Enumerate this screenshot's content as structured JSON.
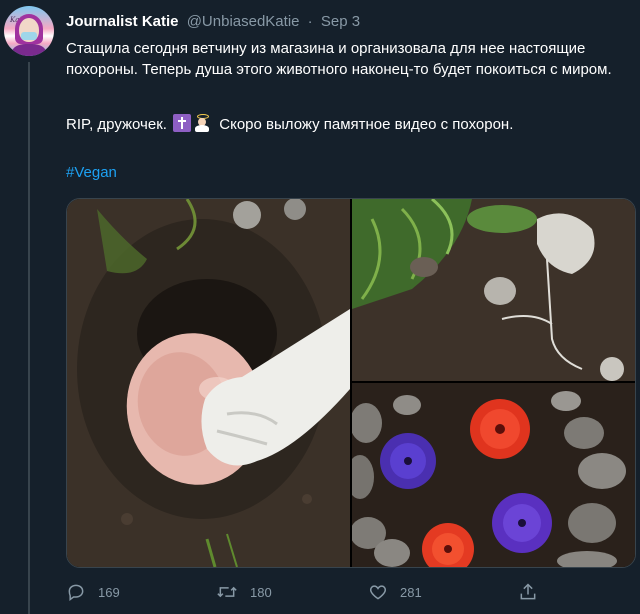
{
  "tweet": {
    "display_name": "Journalist Katie",
    "handle": "@UnbiasedKatie",
    "separator": "·",
    "date": "Sep 3",
    "avatar_label": "Katie",
    "paragraph1": "Стащила сегодня ветчину из магазина и организовала для нее настоящие похороны. Теперь душа этого животного наконец-то будет покоиться с миром.",
    "paragraph2_start": "RIP, дружочек.",
    "paragraph2_end": "Скоро выложу памятное видео с похорон.",
    "hashtag": "#Vegan"
  },
  "icons": {
    "cross_emoji": "latin-cross-emoji",
    "angel_emoji": "baby-angel-emoji",
    "reply": "reply-icon",
    "retweet": "retweet-icon",
    "like": "heart-icon",
    "share": "share-icon"
  },
  "media": {
    "photos": [
      "ham-in-hole-photo",
      "covered-grave-photo",
      "flowers-stones-grave-photo"
    ]
  },
  "actions": {
    "replies": "169",
    "retweets": "180",
    "likes": "281"
  },
  "colors": {
    "background": "#15202b",
    "text": "#ffffff",
    "muted": "#8899a6",
    "link": "#1da1f2",
    "border": "#38444d"
  }
}
